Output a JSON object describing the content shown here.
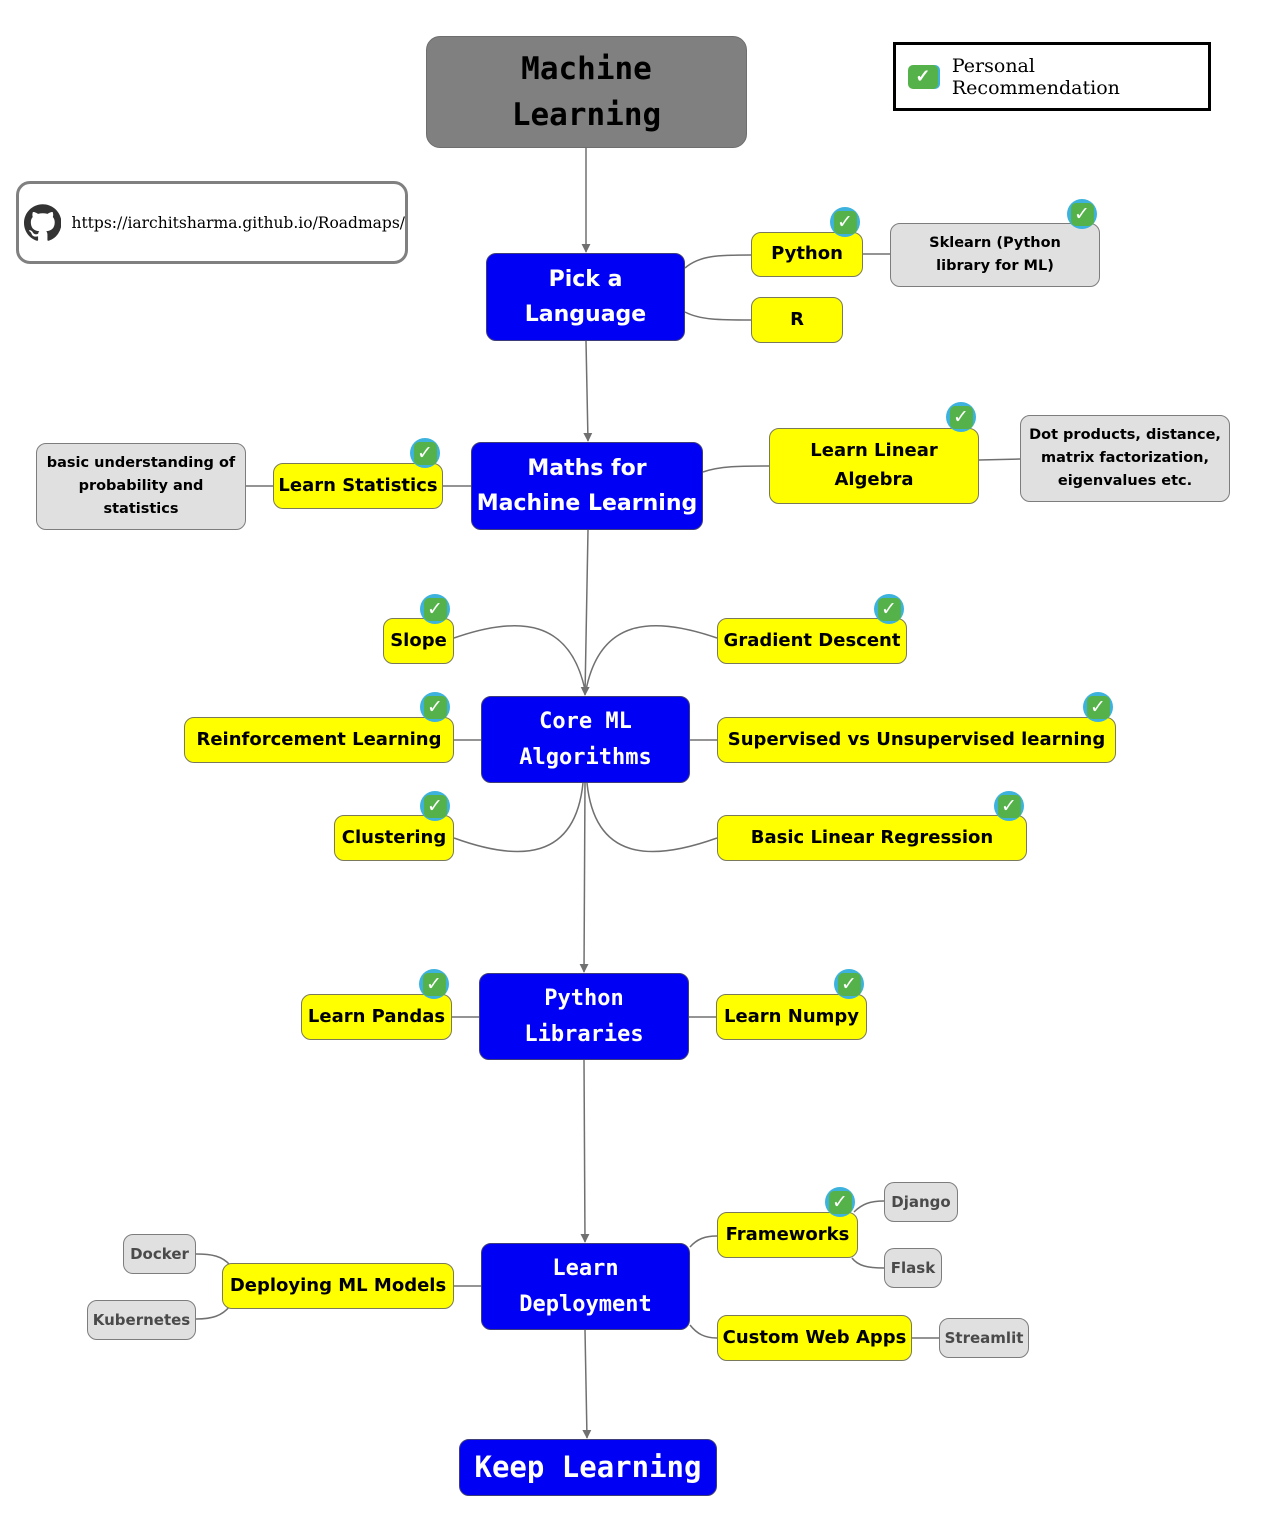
{
  "title": "Machine Learning",
  "legend": {
    "icon": "check-mark-icon",
    "label": "Personal Recommendation"
  },
  "link": {
    "icon": "github-icon",
    "url": "https://iarchitsharma.github.io/Roadmaps/"
  },
  "colors": {
    "root": "#808080",
    "main": "#0000f5",
    "topic": "#ffff00",
    "detail": "#e0e0e0",
    "edge": "#707070"
  },
  "main_steps": [
    {
      "label": "Pick a Language"
    },
    {
      "label": "Maths for Machine Learning"
    },
    {
      "label": "Core ML Algorithms"
    },
    {
      "label": "Python Libraries"
    },
    {
      "label": "Learn Deployment"
    },
    {
      "label": "Keep Learning"
    }
  ],
  "language": {
    "python": {
      "label": "Python",
      "recommended": true
    },
    "r": {
      "label": "R",
      "recommended": false
    },
    "sklearn": {
      "label": "Sklearn (Python library for ML)",
      "recommended": true
    }
  },
  "maths": {
    "statistics": {
      "label": "Learn Statistics",
      "recommended": true
    },
    "statistics_note": {
      "label": "basic understanding of probability and statistics"
    },
    "linear_algebra": {
      "label": "Learn Linear Algebra",
      "recommended": true
    },
    "linear_algebra_note": {
      "label": "Dot products, distance, matrix factorization, eigenvalues etc."
    }
  },
  "core_ml": {
    "slope": {
      "label": "Slope",
      "recommended": true
    },
    "gradient_descent": {
      "label": "Gradient Descent",
      "recommended": true
    },
    "reinforcement": {
      "label": "Reinforcement Learning",
      "recommended": true
    },
    "supervised": {
      "label": "Supervised vs Unsupervised learning",
      "recommended": true
    },
    "clustering": {
      "label": "Clustering",
      "recommended": true
    },
    "linear_regression": {
      "label": "Basic Linear Regression",
      "recommended": true
    }
  },
  "libraries": {
    "pandas": {
      "label": "Learn Pandas",
      "recommended": true
    },
    "numpy": {
      "label": "Learn Numpy",
      "recommended": true
    }
  },
  "deployment": {
    "deploying_models": {
      "label": "Deploying ML Models"
    },
    "docker": {
      "label": "Docker"
    },
    "kubernetes": {
      "label": "Kubernetes"
    },
    "frameworks": {
      "label": "Frameworks",
      "recommended": true
    },
    "django": {
      "label": "Django"
    },
    "flask": {
      "label": "Flask"
    },
    "custom_web_apps": {
      "label": "Custom Web Apps"
    },
    "streamlit": {
      "label": "Streamlit"
    }
  },
  "check_glyph": "✓"
}
